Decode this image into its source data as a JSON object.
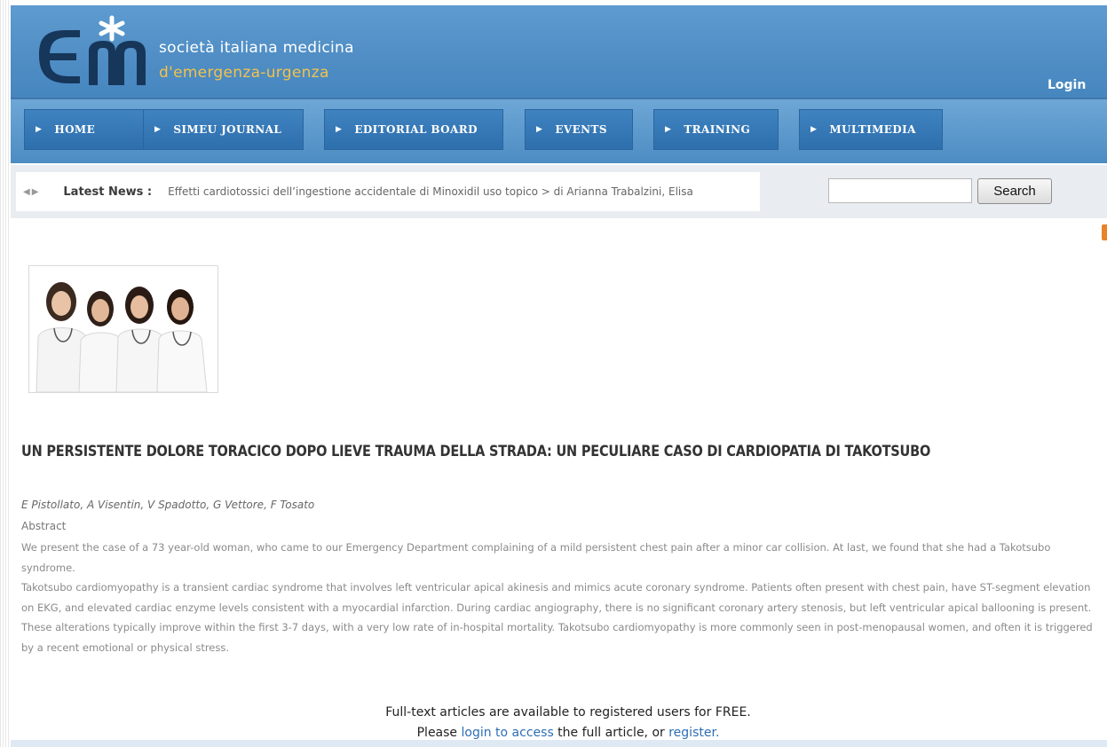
{
  "site": {
    "name_line1": "società italiana  medicina",
    "name_line2": "d'emergenza-urgenza",
    "login_label": "Login",
    "brand_color": "#4f8dc4",
    "accent_color": "#f2c24a"
  },
  "nav": {
    "items": [
      {
        "label": "HOME"
      },
      {
        "label": "SIMEU JOURNAL"
      },
      {
        "label": "EDITORIAL BOARD"
      },
      {
        "label": "EVENTS"
      },
      {
        "label": "TRAINING"
      },
      {
        "label": "MULTIMEDIA"
      }
    ]
  },
  "news": {
    "label": "Latest News :",
    "headline": "Effetti cardiotossici dell’ingestione accidentale di Minoxidil uso topico >  di Arianna Trabalzini, Elisa"
  },
  "search": {
    "value": "",
    "button_label": "Search"
  },
  "article": {
    "title": "UN PERSISTENTE DOLORE TORACICO DOPO LIEVE TRAUMA DELLA STRADA: UN PECULIARE CASO DI CARDIOPATIA DI TAKOTSUBO",
    "authors": "E Pistollato, A Visentin, V Spadotto, G Vettore, F Tosato",
    "abstract_label": "Abstract",
    "paragraph1": "We present the case of a 73 year-old woman, who came to our Emergency Department complaining of a mild persistent chest pain after a minor car collision. At last, we found that she had a Takotsubo syndrome.",
    "paragraph2": "Takotsubo cardiomyopathy is a transient cardiac syndrome that involves left ventricular apical akinesis and mimics acute coronary syndrome. Patients often present with chest pain, have ST-segment elevation on EKG, and elevated cardiac enzyme levels consistent with a myocardial infarction. During cardiac angiography, there is no significant coronary artery stenosis, but left ventricular apical ballooning is present. These alterations typically improve within the first 3-7 days, with a very low rate of in-hospital mortality. Takotsubo cardiomyopathy is more commonly seen in post-menopausal women, and often it is triggered by a recent emotional or physical stress."
  },
  "access": {
    "line1": "Full-text articles are available to registered users for FREE.",
    "line2_prefix": "Please ",
    "login_link": "login to access",
    "line2_middle": " the full article, or ",
    "register_link": "register."
  }
}
